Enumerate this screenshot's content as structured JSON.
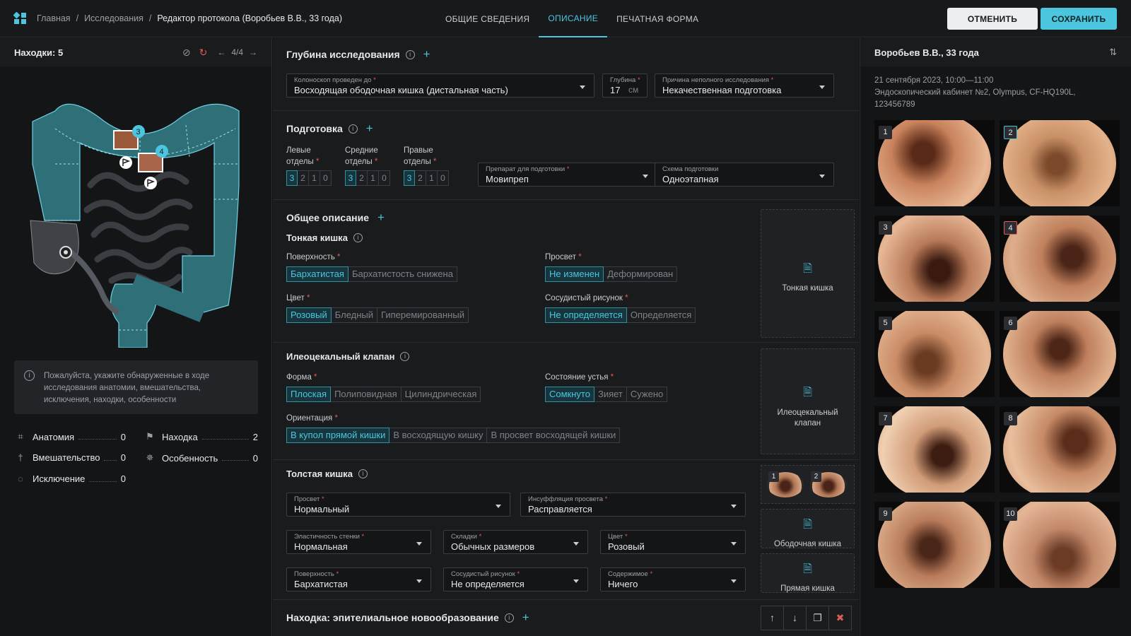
{
  "breadcrumbs": [
    "Главная",
    "Исследования",
    "Редактор протокола (Воробьев В.В., 33 года)"
  ],
  "tabs": [
    {
      "label": "Общие сведения",
      "active": false
    },
    {
      "label": "Описание",
      "active": true
    },
    {
      "label": "Печатная форма",
      "active": false
    }
  ],
  "actions": {
    "cancel": "ОТМЕНИТЬ",
    "save": "СОХРАНИТЬ"
  },
  "colors": {
    "accent": "#4cc6df",
    "required": "#e05a5a",
    "background": "#131416"
  },
  "left": {
    "title": "Находки: 5",
    "pager": "4/4",
    "map_markers": [
      "3",
      "4"
    ],
    "info": "Пожалуйста, укажите обнаруженные в ходе исследования анатомии, вмешательства, исключения, находки, особенности",
    "stats": [
      {
        "label": "Анатомия",
        "count": "0",
        "icon": "crop-icon"
      },
      {
        "label": "Находка",
        "count": "2",
        "icon": "flag-icon"
      },
      {
        "label": "Вмешательство",
        "count": "0",
        "icon": "intervention-icon"
      },
      {
        "label": "Особенность",
        "count": "0",
        "icon": "feature-icon"
      },
      {
        "label": "Исключение",
        "count": "0",
        "icon": "exclusion-icon"
      }
    ]
  },
  "depth": {
    "title": "Глубина исследования",
    "colonoscope_label": "Колоноскоп проведен до",
    "colonoscope_value": "Восходящая ободочная кишка (дистальная часть)",
    "depth_label": "Глубина",
    "depth_value": "17",
    "depth_unit": "см",
    "reason_label": "Причина неполного исследования",
    "reason_value": "Некачественная подготовка"
  },
  "prep": {
    "title": "Подготовка",
    "left_label": "Левые отделы",
    "mid_label": "Средние отделы",
    "right_label": "Правые отделы",
    "scores": [
      "3",
      "2",
      "1",
      "0"
    ],
    "drug_label": "Препарат для подготовки",
    "drug_value": "Мовипреп",
    "scheme_label": "Схема подготовки",
    "scheme_value": "Одноэтапная"
  },
  "general": {
    "title": "Общее описание",
    "small_intestine": "Тонкая кишка",
    "surface_label": "Поверхность",
    "surface_opts": [
      "Бархатистая",
      "Бархатистость снижена"
    ],
    "lumen_label": "Просвет",
    "lumen_opts": [
      "Не изменен",
      "Деформирован"
    ],
    "color_label": "Цвет",
    "color_opts": [
      "Розовый",
      "Бледный",
      "Гиперемированный"
    ],
    "vascular_label": "Сосудистый рисунок",
    "vascular_opts": [
      "Не определяется",
      "Определяется"
    ],
    "dropzone": "Тонкая кишка"
  },
  "valve": {
    "title": "Илеоцекальный клапан",
    "form_label": "Форма",
    "form_opts": [
      "Плоская",
      "Полиповидная",
      "Цилиндрическая"
    ],
    "orifice_label": "Состояние устья",
    "orifice_opts": [
      "Сомкнуто",
      "Зияет",
      "Сужено"
    ],
    "orient_label": "Ориентация",
    "orient_opts": [
      "В купол прямой кишки",
      "В восходящую кишку",
      "В просвет восходящей кишки"
    ],
    "dropzone": "Илеоцекальный клапан"
  },
  "colon": {
    "title": "Толстая кишка",
    "lumen_label": "Просвет",
    "lumen_value": "Нормальный",
    "insufflation_label": "Инсуффляция просвета",
    "insufflation_value": "Расправляется",
    "elasticity_label": "Эластичность стенки",
    "elasticity_value": "Нормальная",
    "folds_label": "Складки",
    "folds_value": "Обычных размеров",
    "color_label": "Цвет",
    "color_value": "Розовый",
    "surface_label": "Поверхность",
    "surface_value": "Бархатистая",
    "vascular_label": "Сосудистый рисунок",
    "vascular_value": "Не определяется",
    "content_label": "Содержимое",
    "content_value": "Ничего",
    "thumb_nums": [
      "1",
      "2"
    ],
    "drop_colon": "Ободочная кишка",
    "drop_rectum": "Прямая кишка"
  },
  "finding": {
    "title": "Находка: эпителиальное новообразование"
  },
  "right": {
    "patient": "Воробьев В.В., 33 года",
    "datetime": "21 сентября 2023, 10:00—11:00",
    "room": "Эндоскопический кабинет №2, Olympus, CF-HQ190L, 123456789",
    "photos": [
      "1",
      "2",
      "3",
      "4",
      "5",
      "6",
      "7",
      "8",
      "9",
      "10"
    ]
  }
}
